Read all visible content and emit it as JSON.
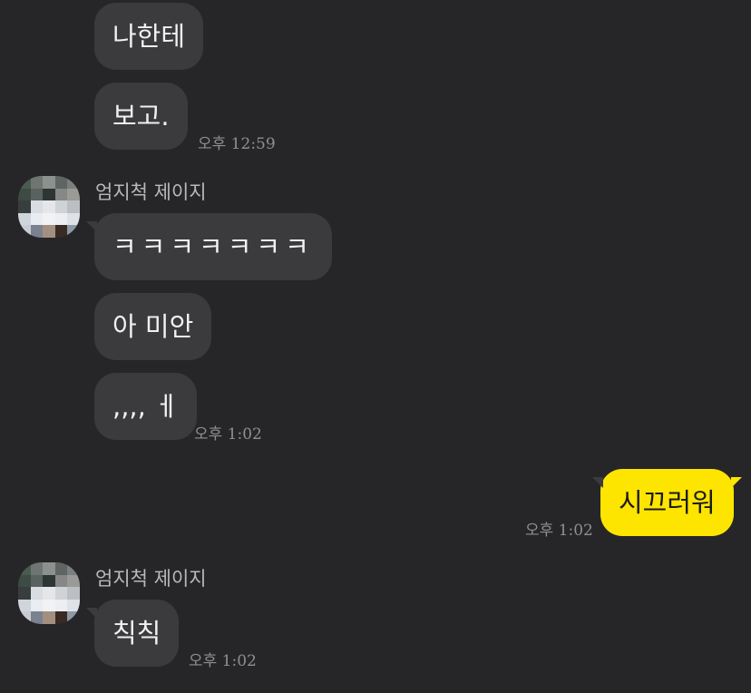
{
  "messages": [
    {
      "text": "나한테"
    },
    {
      "text": "보고.",
      "time": "오후 12:59"
    },
    {
      "sender": "엄지척 제이지"
    },
    {
      "text": "ㅋㅋㅋㅋㅋㅋㅋ"
    },
    {
      "text": "아 미안"
    },
    {
      "text": ",,,, ㅔ",
      "time": "오후 1:02"
    },
    {
      "text": "시끄러워",
      "time": "오후 1:02"
    },
    {
      "sender": "엄지척 제이지"
    },
    {
      "text": "칙칙",
      "time": "오후 1:02"
    }
  ],
  "colors": {
    "background": "#262628",
    "received_bubble": "#3b3b3e",
    "sent_bubble": "#fee500",
    "timestamp": "#8f8f92",
    "sender_name": "#b9b9bb"
  }
}
